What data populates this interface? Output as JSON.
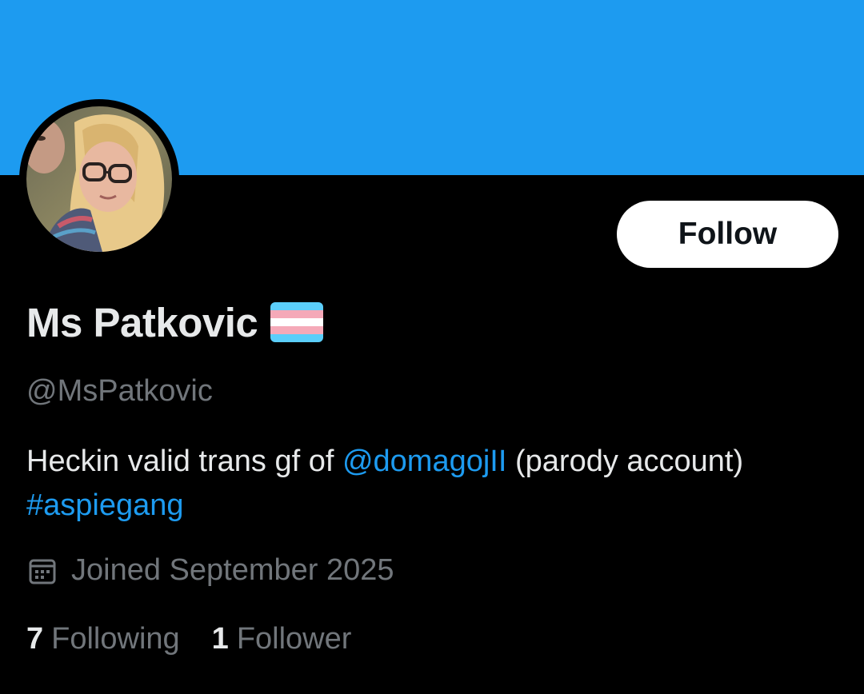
{
  "header": {
    "banner_color": "#1d9bf0"
  },
  "profile": {
    "avatar_icon": "profile-photo",
    "display_name": "Ms Patkovic",
    "name_badge_icon": "transgender-flag-emoji",
    "handle": "@MsPatkovic",
    "follow_label": "Follow",
    "bio": {
      "text_1": "Heckin valid trans gf of ",
      "mention": "@domagojII",
      "text_2": " (parody account) ",
      "hashtag": "#aspiegang"
    },
    "joined_icon": "calendar-icon",
    "joined": "Joined September 2025",
    "following_count": "7",
    "following_label": "Following",
    "followers_count": "1",
    "followers_label": "Follower"
  },
  "colors": {
    "background": "#000000",
    "primary_text": "#e7e9ea",
    "secondary_text": "#71767b",
    "link": "#1d9bf0",
    "button_bg": "#ffffff"
  }
}
